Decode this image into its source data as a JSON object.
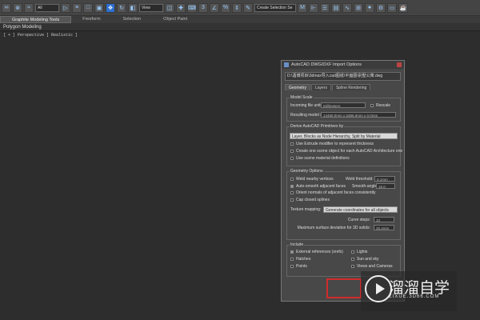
{
  "toolbar": {
    "filter_value": "All",
    "view_value": "View",
    "selection_set": "Create Selection Se"
  },
  "ribbon": {
    "tabs": [
      "Graphite Modeling Tools",
      "Freeform",
      "Selection",
      "Object Paint"
    ],
    "active": "Graphite Modeling Tools",
    "sub_label": "Polygon Modeling"
  },
  "viewport": {
    "label": "[ + ] Perspective ] Realistic ]"
  },
  "dialog": {
    "title": "AutoCAD DWG/DXF Import Options",
    "path": "D:\\酒博项目\\3dmax导入cad图纸\\平面图\\别墅公寓.dwg",
    "tabs": [
      "Geometry",
      "Layers",
      "Spline Rendering"
    ],
    "model_scale": {
      "title": "Model Scale",
      "units_label": "Incoming file units:",
      "units_value": "Millimeters",
      "rescale_label": "Rescale",
      "size_label": "Resulting model size:",
      "size_value": "14480.0mm x 5385.0mm x 0.0mm"
    },
    "derive": {
      "title": "Derive AutoCAD Primitives by",
      "value": "Layer, Blocks as Node Hierarchy, Split by Material",
      "options": [
        "Use Extrude modifier to represent thickness",
        "Create one scene object for each AutoCAD Architecture one",
        "Use scene material definitions"
      ]
    },
    "geometry": {
      "title": "Geometry Options",
      "weld_label": "Weld nearby vertices",
      "weld_threshold_label": "Weld threshold:",
      "weld_threshold_value": "0.1mm",
      "smooth_label": "Auto-smooth adjacent faces",
      "smooth_angle_label": "Smooth-angle:",
      "smooth_angle_value": "15.0",
      "orient_label": "Orient normals of adjacent faces consistently",
      "cap_label": "Cap closed splines",
      "texture_label": "Texture mapping:",
      "texture_value": "Generate coordinates for all objects",
      "curve_label": "Curve steps:",
      "curve_value": "10",
      "deviation_label": "Maximum surface deviation for 3D solids:",
      "deviation_value": "25.4mm"
    },
    "include": {
      "title": "Include",
      "left": [
        "External references (xrefs)",
        "Hatches",
        "Points"
      ],
      "right": [
        "Lights",
        "Sun and sky",
        "Views and Cameras"
      ]
    }
  },
  "watermark": {
    "text": "溜溜自学",
    "url": "ZIXUE.3D66.COM"
  }
}
